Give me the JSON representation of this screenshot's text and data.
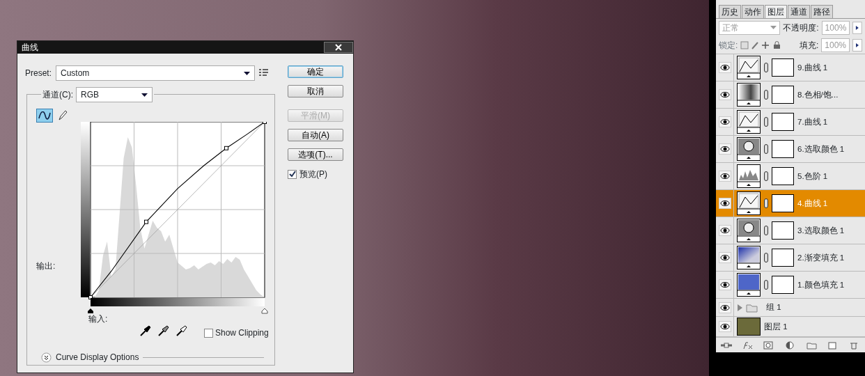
{
  "dialog": {
    "title": "曲线",
    "preset_label": "Preset:",
    "preset_value": "Custom",
    "channel_label": "通道(C):",
    "channel_value": "RGB",
    "tools": [
      {
        "kind": "curve",
        "selected": true
      },
      {
        "kind": "pencil",
        "selected": false
      }
    ],
    "output_label": "输出:",
    "input_label": "输入:",
    "show_clipping": {
      "label": "Show Clipping",
      "checked": false
    },
    "curve_display_options": "Curve Display Options",
    "buttons": [
      {
        "label": "确定",
        "default": true,
        "disabled": false
      },
      {
        "label": "取消",
        "default": false,
        "disabled": false
      },
      {
        "label": "平滑(M)",
        "default": false,
        "disabled": true
      },
      {
        "label": "自动(A)",
        "default": false,
        "disabled": false
      },
      {
        "label": "选项(T)...",
        "default": false,
        "disabled": false
      }
    ],
    "preview": {
      "label": "预览(P)",
      "checked": true
    }
  },
  "layers_panel": {
    "tabs": [
      {
        "label": "历史",
        "selected": false
      },
      {
        "label": "动作",
        "selected": false
      },
      {
        "label": "图层",
        "selected": true
      },
      {
        "label": "通道",
        "selected": false
      },
      {
        "label": "路径",
        "selected": false
      }
    ],
    "blend_mode": "正常",
    "opacity_label": "不透明度:",
    "opacity": "100%",
    "lock_label": "锁定:",
    "fill_label": "填充:",
    "fill": "100%",
    "layers": [
      {
        "name": "9.曲线 1",
        "kind": "curves",
        "visible": true,
        "selected": false
      },
      {
        "name": "8.色相/饱...",
        "kind": "hue",
        "visible": true,
        "selected": false
      },
      {
        "name": "7.曲线 1",
        "kind": "curves",
        "visible": true,
        "selected": false
      },
      {
        "name": "6.选取颜色 1",
        "kind": "selective",
        "visible": true,
        "selected": false
      },
      {
        "name": "5.色阶 1",
        "kind": "levels",
        "visible": true,
        "selected": false
      },
      {
        "name": "4.曲线 1",
        "kind": "curves",
        "visible": true,
        "selected": true
      },
      {
        "name": "3.选取颜色 1",
        "kind": "selective",
        "visible": true,
        "selected": false
      },
      {
        "name": "2.渐变填充 1",
        "kind": "gradient",
        "visible": true,
        "selected": false
      },
      {
        "name": "1.颜色填充 1",
        "kind": "solid",
        "visible": true,
        "selected": false
      },
      {
        "name": "组 1",
        "kind": "group",
        "visible": true,
        "selected": false
      },
      {
        "name": "图层 1",
        "kind": "image",
        "visible": true,
        "selected": false
      }
    ]
  }
}
